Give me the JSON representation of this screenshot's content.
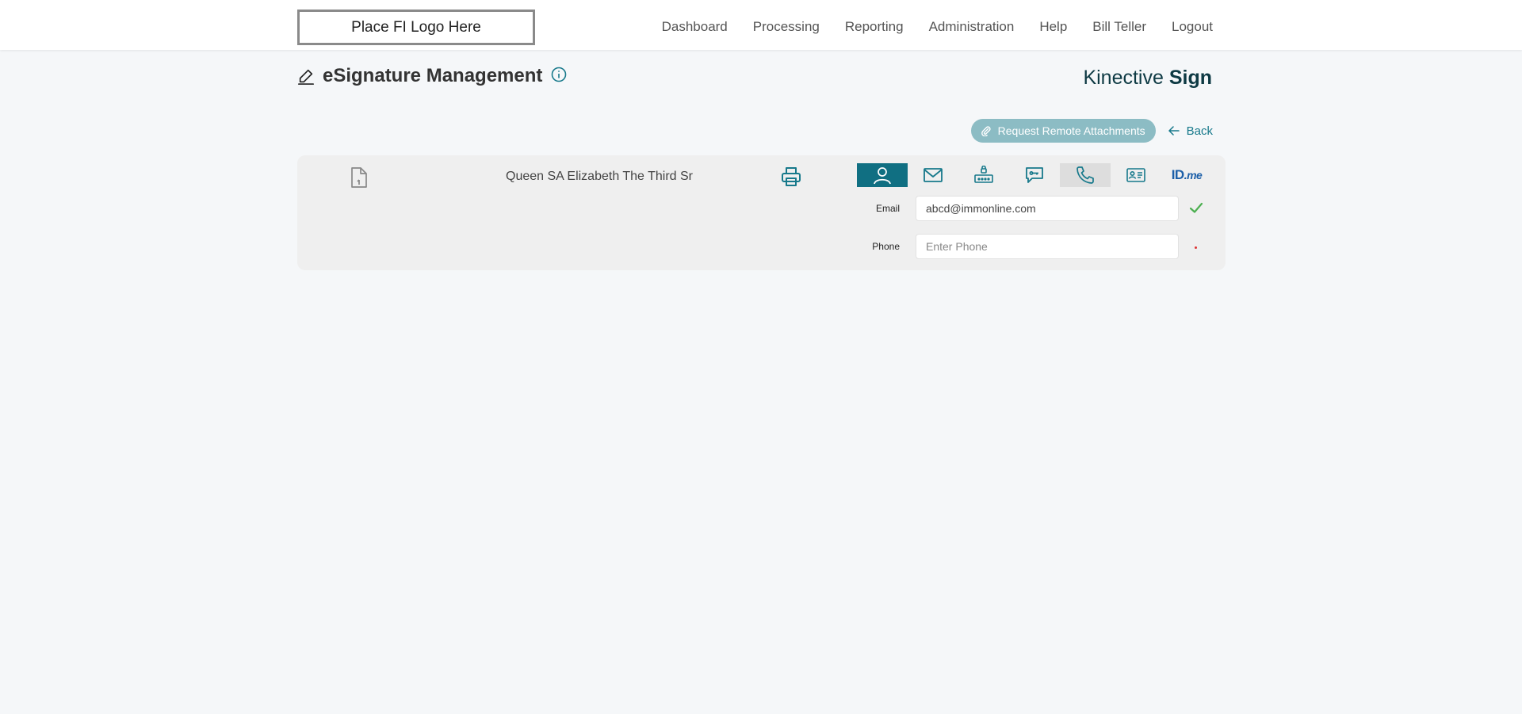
{
  "header": {
    "logo_text": "Place FI Logo Here",
    "nav": [
      "Dashboard",
      "Processing",
      "Reporting",
      "Administration",
      "Help",
      "Bill Teller",
      "Logout"
    ]
  },
  "page": {
    "title": "eSignature Management",
    "brand_light": "Kinective ",
    "brand_bold": "Sign"
  },
  "actions": {
    "request_attachments": "Request Remote Attachments",
    "back": "Back"
  },
  "signer": {
    "name": "Queen SA Elizabeth The Third Sr",
    "tabs": [
      "person-icon",
      "mail-icon",
      "lock-keypad-icon",
      "chat-key-icon",
      "phone-icon",
      "id-card-icon",
      "idme-icon"
    ],
    "active_tab": "person-icon",
    "idme_text": "ID",
    "idme_suffix": ".me",
    "email_label": "Email",
    "email_value": "abcd@immonline.com",
    "phone_label": "Phone",
    "phone_placeholder": "Enter Phone"
  },
  "colors": {
    "accent": "#106f82",
    "attach_button": "#8cbcc4",
    "check": "#4caf50",
    "required": "#dd3333"
  }
}
